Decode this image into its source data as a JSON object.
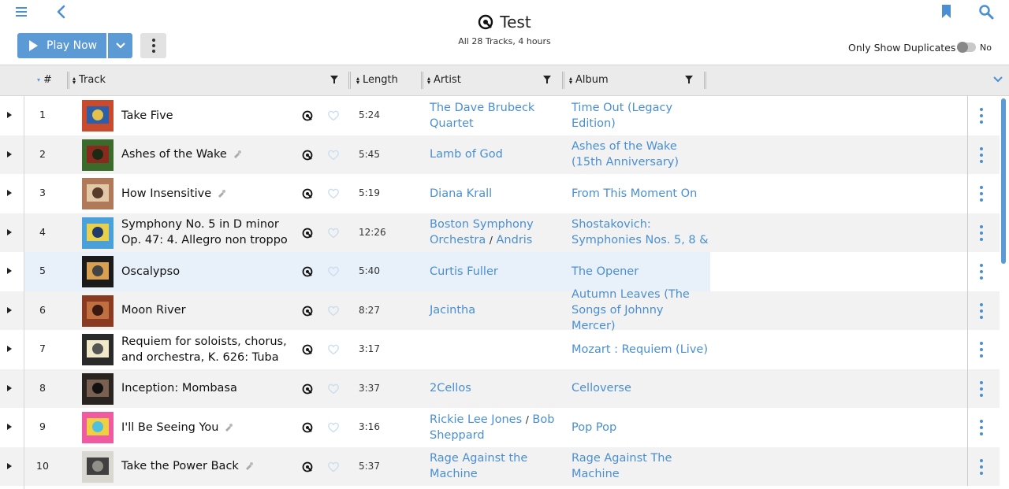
{
  "header": {
    "title": "Test",
    "subtitle": "All 28 Tracks, 4 hours",
    "play_label": "Play Now",
    "duplicates_label": "Only Show Duplicates",
    "toggle_state": "No"
  },
  "columns": {
    "num": "#",
    "track": "Track",
    "length": "Length",
    "artist": "Artist",
    "album": "Album"
  },
  "colors": {
    "accent": "#5c9ad6",
    "link": "#4a8fd1",
    "highlight": "#e8f1fa"
  },
  "rows": [
    {
      "num": "1",
      "track": "Take Five",
      "length": "5:24",
      "artist": "The Dave Brubeck Quartet",
      "artist2": "",
      "album": "Time Out (Legacy Edition)",
      "tag": false
    },
    {
      "num": "2",
      "track": "Ashes of the Wake",
      "length": "5:45",
      "artist": "Lamb of God",
      "artist2": "",
      "album": "Ashes of the Wake (15th Anniversary)",
      "tag": true
    },
    {
      "num": "3",
      "track": "How Insensitive",
      "length": "5:19",
      "artist": "Diana Krall",
      "artist2": "",
      "album": "From This Moment On",
      "tag": true
    },
    {
      "num": "4",
      "track": "Symphony No. 5 in D minor Op. 47: 4. Allegro non troppo -",
      "length": "12:26",
      "artist": "Boston Symphony Orchestra",
      "artist2": "Andris",
      "album": "Shostakovich: Symphonies Nos. 5, 8 &",
      "tag": false
    },
    {
      "num": "5",
      "track": "Oscalypso",
      "length": "5:40",
      "artist": "Curtis Fuller",
      "artist2": "",
      "album": "The Opener",
      "tag": false
    },
    {
      "num": "6",
      "track": "Moon River",
      "length": "8:27",
      "artist": "Jacintha",
      "artist2": "",
      "album": "Autumn Leaves (The Songs of Johnny Mercer)",
      "tag": false
    },
    {
      "num": "7",
      "track": "Requiem for soloists, chorus, and orchestra, K. 626: Tuba",
      "length": "3:17",
      "artist": "",
      "artist2": "",
      "album": "Mozart : Requiem (Live)",
      "tag": false
    },
    {
      "num": "8",
      "track": "Inception: Mombasa",
      "length": "3:37",
      "artist": "2Cellos",
      "artist2": "",
      "album": "Celloverse",
      "tag": false
    },
    {
      "num": "9",
      "track": "I'll Be Seeing You",
      "length": "3:16",
      "artist": "Rickie Lee Jones",
      "artist2": "Bob Sheppard",
      "album": "Pop Pop",
      "tag": true
    },
    {
      "num": "10",
      "track": "Take the Power Back",
      "length": "5:37",
      "artist": "Rage Against the Machine",
      "artist2": "",
      "album": "Rage Against The Machine",
      "tag": true
    }
  ]
}
